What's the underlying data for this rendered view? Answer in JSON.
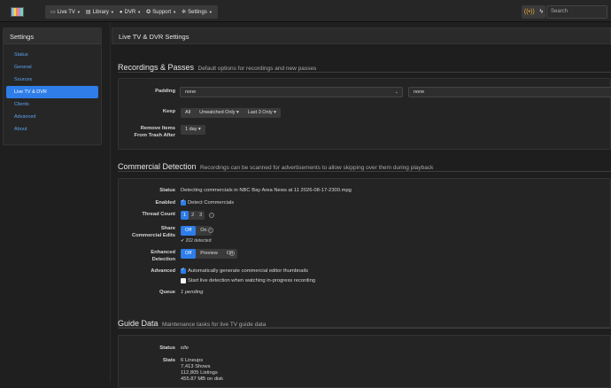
{
  "topbar": {
    "nav": [
      {
        "icon": "tv-icon",
        "glyph": "▭",
        "label": "Live TV"
      },
      {
        "icon": "book-icon",
        "glyph": "▤",
        "label": "Library"
      },
      {
        "icon": "record-icon",
        "glyph": "●",
        "label": "DVR"
      },
      {
        "icon": "support-icon",
        "glyph": "✪",
        "label": "Support"
      },
      {
        "icon": "gear-icon",
        "glyph": "✲",
        "label": "Settings"
      }
    ],
    "search_placeholder": "Search",
    "colors": {
      "accent": "#2e7de9",
      "antenna": "#f0a830"
    }
  },
  "sidebar": {
    "title": "Settings",
    "items": [
      "Status",
      "General",
      "Sources",
      "Live TV & DVR",
      "Clients",
      "Advanced",
      "About"
    ],
    "active": "Live TV & DVR"
  },
  "main": {
    "panel_title": "Live TV & DVR Settings",
    "recordings": {
      "title": "Recordings & Passes",
      "subtitle": "Default options for recordings and new passes",
      "padding_label": "Padding",
      "padding_before": "none",
      "padding_after": "none",
      "keep_label": "Keep",
      "keep_all": "All",
      "keep_unwatched": "Unwatched Only",
      "keep_last": "Last 3 Only",
      "trash_label_1": "Remove Items",
      "trash_label_2": "From Trash After",
      "trash_value": "1 day"
    },
    "commercial": {
      "title": "Commercial Detection",
      "subtitle": "Recordings can be scanned for advertisements to allow skipping over them during playback",
      "status_label": "Status",
      "status_value": "Detecting commercials in NBC Bay Area News at 11 2026-08-17-2300.mpg",
      "enabled_label": "Enabled",
      "enabled_text": "Detect Commercials",
      "threads_label": "Thread Count",
      "threads": [
        "1",
        "2",
        "3"
      ],
      "share_label_1": "Share",
      "share_label_2": "Commercial Edits",
      "share_off": "Off",
      "share_on": "On",
      "share_detected": "✔ 202 detected",
      "enh_label_1": "Enhanced",
      "enh_label_2": "Detection",
      "enh_off": "Off",
      "enh_preview": "Preview",
      "enh_on": "On",
      "advanced_label": "Advanced",
      "adv_opt1": "Automatically generate commercial editor thumbnails",
      "adv_opt2": "Start live detection when watching in-progress recording",
      "queue_label": "Queue",
      "queue_value": "1 pending"
    },
    "guide": {
      "title": "Guide Data",
      "subtitle": "Maintenance tasks for live TV guide data",
      "status_label": "Status",
      "status_value": "idle",
      "stats_label": "Stats",
      "stats": [
        "6 Lineups",
        "7,413 Shows",
        "112,805 Listings",
        "455.87 MB on disk"
      ]
    }
  }
}
